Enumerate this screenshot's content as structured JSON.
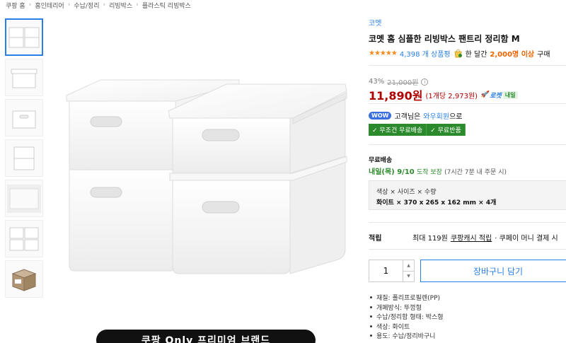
{
  "breadcrumb": [
    "쿠팡 홈",
    "홈인테리어",
    "수납/정리",
    "리빙박스",
    "플라스틱 리빙박스"
  ],
  "brand": "코멧",
  "title": "코멧 홈 심플한 리빙박스 팬트리 정리함 M",
  "rating": {
    "stars": "★★★★★",
    "review_count": "4,398 개 상품평",
    "month_prefix": "한 달간",
    "month_count": "2,000명 이상",
    "month_suffix": "구매"
  },
  "price": {
    "discount": "43%",
    "original": "21,000원",
    "sale": "11,890원",
    "unit": "(1개당 2,973원)",
    "rocket": "로켓",
    "rocket_tag": "내일"
  },
  "wow": {
    "badge": "WOW",
    "text_prefix": "고객님은",
    "link": "와우회원",
    "text_suffix": "으로",
    "badges": [
      "✓ 무조건 무료배송",
      "✓ 무료반품"
    ]
  },
  "shipping": {
    "label": "무료배송",
    "date": "내일(목) 9/10",
    "guarantee": "도착 보장",
    "note": "(7시간 7분 내 주문 시)"
  },
  "option": {
    "header": "색상 × 사이즈 × 수량",
    "value": "화이트 × 370 x 265 x 162 mm × 4개"
  },
  "points": {
    "label": "적립",
    "prefix": "최대 119원",
    "link": "쿠팡캐시 적립",
    "suffix": "· 쿠페이 머니 결제 시"
  },
  "quantity": "1",
  "cart_button": "장바구니 담기",
  "specs": [
    "재질: 폴리프로필렌(PP)",
    "개폐방식: 뚜껑형",
    "수납/정리함 형태: 박스형",
    "색상: 화이트",
    "용도: 수납/정리바구니"
  ],
  "promo_banner": "쿠팡 Only 프리미엄 브랜드",
  "colors": {
    "accent": "#2a7fe6",
    "price": "#ae0000",
    "green": "#2b8a2b",
    "orange": "#e96300"
  }
}
